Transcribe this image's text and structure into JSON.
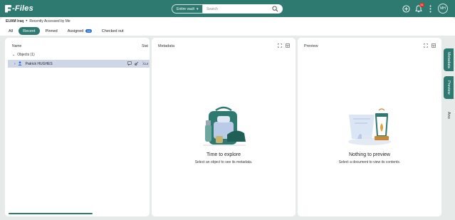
{
  "app": {
    "logo_text": "-Files"
  },
  "search": {
    "scope_label": "Entire vault",
    "placeholder": "Search"
  },
  "topbar": {
    "notification_count": "31",
    "avatar_initials": "MH"
  },
  "breadcrumb": {
    "vault": "EUAM Iraq",
    "view": "Recently Accessed by Me"
  },
  "tabs": [
    {
      "label": "All"
    },
    {
      "label": "Recent"
    },
    {
      "label": "Pinned"
    },
    {
      "label": "Assigned",
      "count": "10"
    },
    {
      "label": "Checked out"
    }
  ],
  "list": {
    "col_name": "Name",
    "col_status": "Stat",
    "group_label": "Objects (1)",
    "rows": [
      {
        "name": "Patrick HUGHES",
        "status": "Cur"
      }
    ]
  },
  "metadata": {
    "title": "Metadata",
    "empty_title": "Time to explore",
    "empty_sub": "Select an object to see its metadata."
  },
  "preview": {
    "title": "Preview",
    "empty_title": "Nothing to preview",
    "empty_sub": "Select a document to view its contents."
  },
  "rail": {
    "metadata": "Metadata",
    "preview": "Preview",
    "third": "Ano"
  },
  "colors": {
    "brand": "#2f7a70",
    "background": "#e6ebea",
    "selected_row": "#cfd6e8",
    "badge": "#d93025"
  }
}
